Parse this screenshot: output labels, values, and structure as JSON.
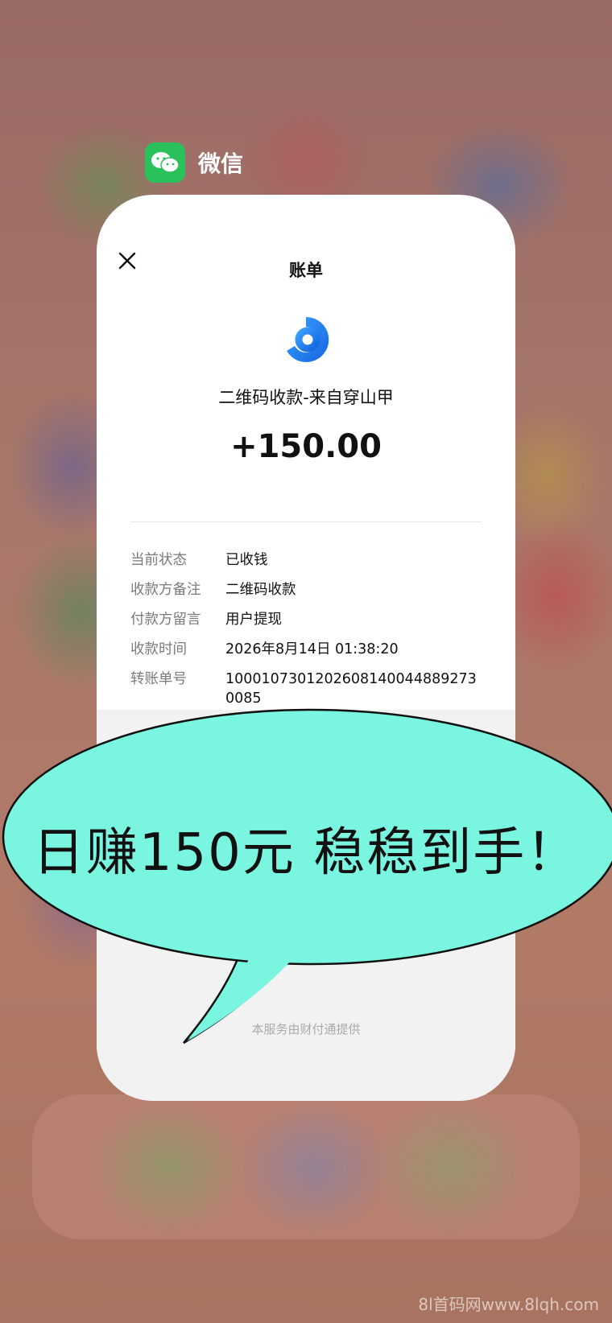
{
  "app": {
    "name": "微信",
    "icon": "wechat-icon",
    "icon_color": "#2ac15b"
  },
  "bill": {
    "title": "账单",
    "close_icon": "close-icon",
    "merchant_logo": "pay-logo-icon",
    "payer_line": "二维码收款-来自穿山甲",
    "amount": "+150.00",
    "details": [
      {
        "label": "当前状态",
        "value": "已收钱"
      },
      {
        "label": "收款方备注",
        "value": "二维码收款"
      },
      {
        "label": "付款方留言",
        "value": "用户提现"
      },
      {
        "label": "收款时间",
        "value": "2026年8月14日 01:38:20"
      },
      {
        "label": "转账单号",
        "value": "10001073012026081400448892730085"
      }
    ],
    "footer": "本服务由财付通提供"
  },
  "overlay": {
    "slogan": "日赚150元 稳稳到手！",
    "bubble_color": "#7af5e0"
  },
  "watermark": "8l首码网www.8lqh.com"
}
